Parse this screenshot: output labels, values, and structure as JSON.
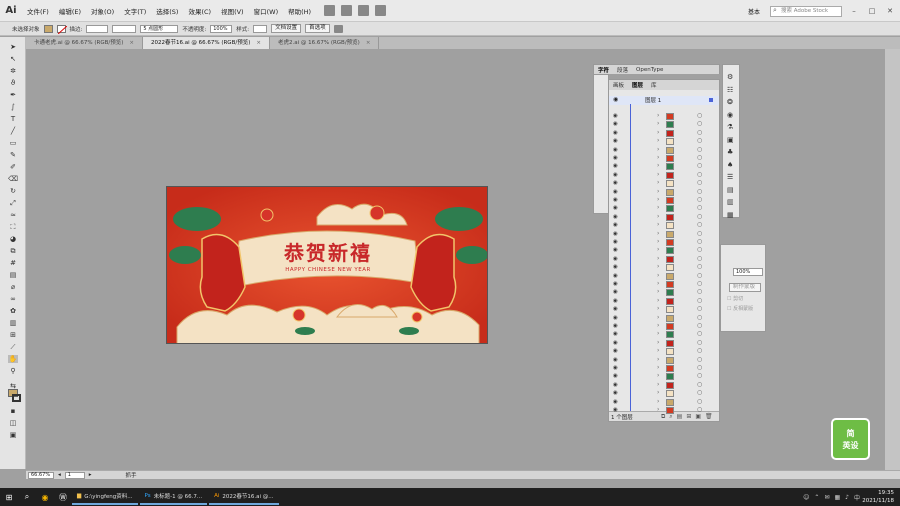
{
  "app": {
    "logo": "Ai"
  },
  "menu": [
    "文件(F)",
    "编辑(E)",
    "对象(O)",
    "文字(T)",
    "选择(S)",
    "效果(C)",
    "视图(V)",
    "窗口(W)",
    "帮助(H)"
  ],
  "workspace": "基本",
  "search_placeholder": "搜索 Adobe Stock",
  "window_buttons": [
    "–",
    "□",
    "✕"
  ],
  "control_bar": {
    "selection_label": "未选择对象",
    "stroke_label": "描边:",
    "stroke_value": "",
    "brush_value": "5 点圆形",
    "opacity_label": "不透明度:",
    "opacity_value": "100%",
    "style_label": "样式:",
    "doc_setup": "文档设置",
    "prefs": "首选项"
  },
  "tabs": [
    {
      "label": "卡通老虎.ai @ 66.67% (RGB/预览)"
    },
    {
      "label": "2022春节16.ai @ 66.67% (RGB/预览)",
      "active": true
    },
    {
      "label": "老虎2.ai @ 16.67% (RGB/预览)"
    }
  ],
  "artwork": {
    "title": "恭贺新禧",
    "subtitle": "HAPPY CHINESE NEW YEAR",
    "bg_color": "#d33b22",
    "accent_color": "#f4e2c4"
  },
  "layers_panel": {
    "tabs_top": [
      "字符",
      "段落",
      "OpenType"
    ],
    "tabs": [
      "画板",
      "图层",
      "库"
    ],
    "layer_name": "图层 1",
    "footer": "1 个图层"
  },
  "transparency_panel": {
    "opacity_value": "100%",
    "make_mask": "制作蒙版",
    "clip": "剪切",
    "invert": "反相蒙版"
  },
  "status_bar": {
    "zoom": "66.67%",
    "page": "1",
    "mode": "抓手"
  },
  "taskbar": {
    "items": [
      {
        "label": "G:\\yingfeng资料..."
      },
      {
        "label": "未标题-1 @ 66.7..."
      },
      {
        "label": "2022春节16.ai @..."
      }
    ],
    "time": "19:35",
    "date": "2021/11/18"
  },
  "watermark": {
    "line1": "简",
    "line2": "英设"
  }
}
